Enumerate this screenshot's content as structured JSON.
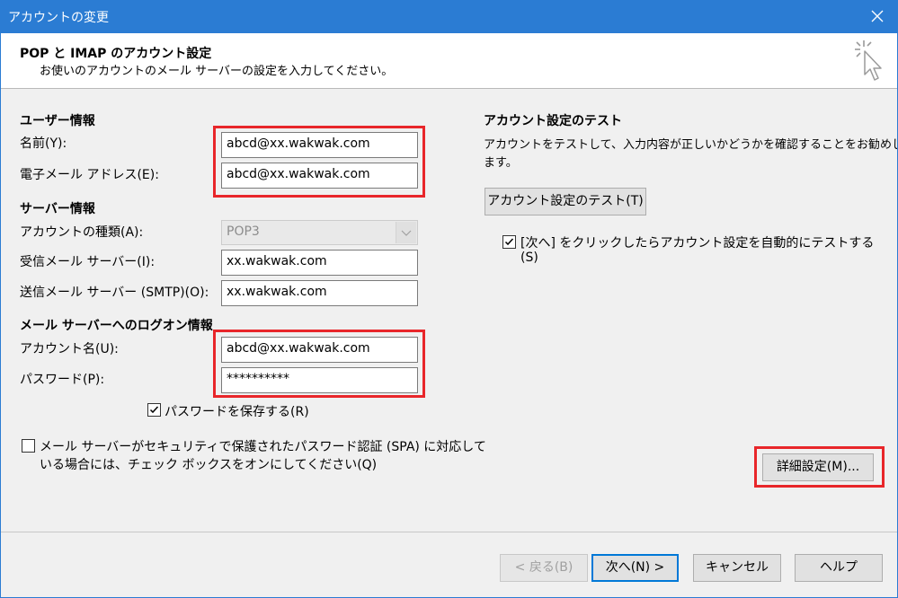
{
  "window": {
    "title": "アカウントの変更"
  },
  "header": {
    "title": "POP と IMAP のアカウント設定",
    "subtitle": "お使いのアカウントのメール サーバーの設定を入力してください。"
  },
  "user_info": {
    "section": "ユーザー情報",
    "name_label": "名前(Y):",
    "name_value": "abcd@xx.wakwak.com",
    "email_label": "電子メール アドレス(E):",
    "email_value": "abcd@xx.wakwak.com"
  },
  "server_info": {
    "section": "サーバー情報",
    "account_type_label": "アカウントの種類(A):",
    "account_type_value": "POP3",
    "incoming_label": "受信メール サーバー(I):",
    "incoming_value": "xx.wakwak.com",
    "outgoing_label": "送信メール サーバー (SMTP)(O):",
    "outgoing_value": "xx.wakwak.com"
  },
  "logon_info": {
    "section": "メール サーバーへのログオン情報",
    "account_label": "アカウント名(U):",
    "account_value": "abcd@xx.wakwak.com",
    "password_label": "パスワード(P):",
    "password_value": "**********",
    "save_password_label": "パスワードを保存する(R)",
    "save_password_checked": true,
    "spa_label_line1": "メール サーバーがセキュリティで保護されたパスワード認証 (SPA) に対応して",
    "spa_label_line2": "いる場合には、チェック ボックスをオンにしてください(Q)",
    "spa_checked": false
  },
  "test": {
    "section": "アカウント設定のテスト",
    "description_line1": "アカウントをテストして、入力内容が正しいかどうかを確認することをお勧めし",
    "description_line2": "ます。",
    "test_button": "アカウント設定のテスト(T)",
    "auto_test_line1": "[次へ] をクリックしたらアカウント設定を自動的にテストする",
    "auto_test_line2": "(S)",
    "auto_test_checked": true
  },
  "advanced_button": "詳細設定(M)...",
  "footer": {
    "back": "< 戻る(B)",
    "next": "次へ(N) >",
    "cancel": "キャンセル",
    "help": "ヘルプ"
  },
  "colors": {
    "titlebar": "#2b7cd3",
    "highlight": "#e8262a",
    "default_button_border": "#0078d7"
  }
}
